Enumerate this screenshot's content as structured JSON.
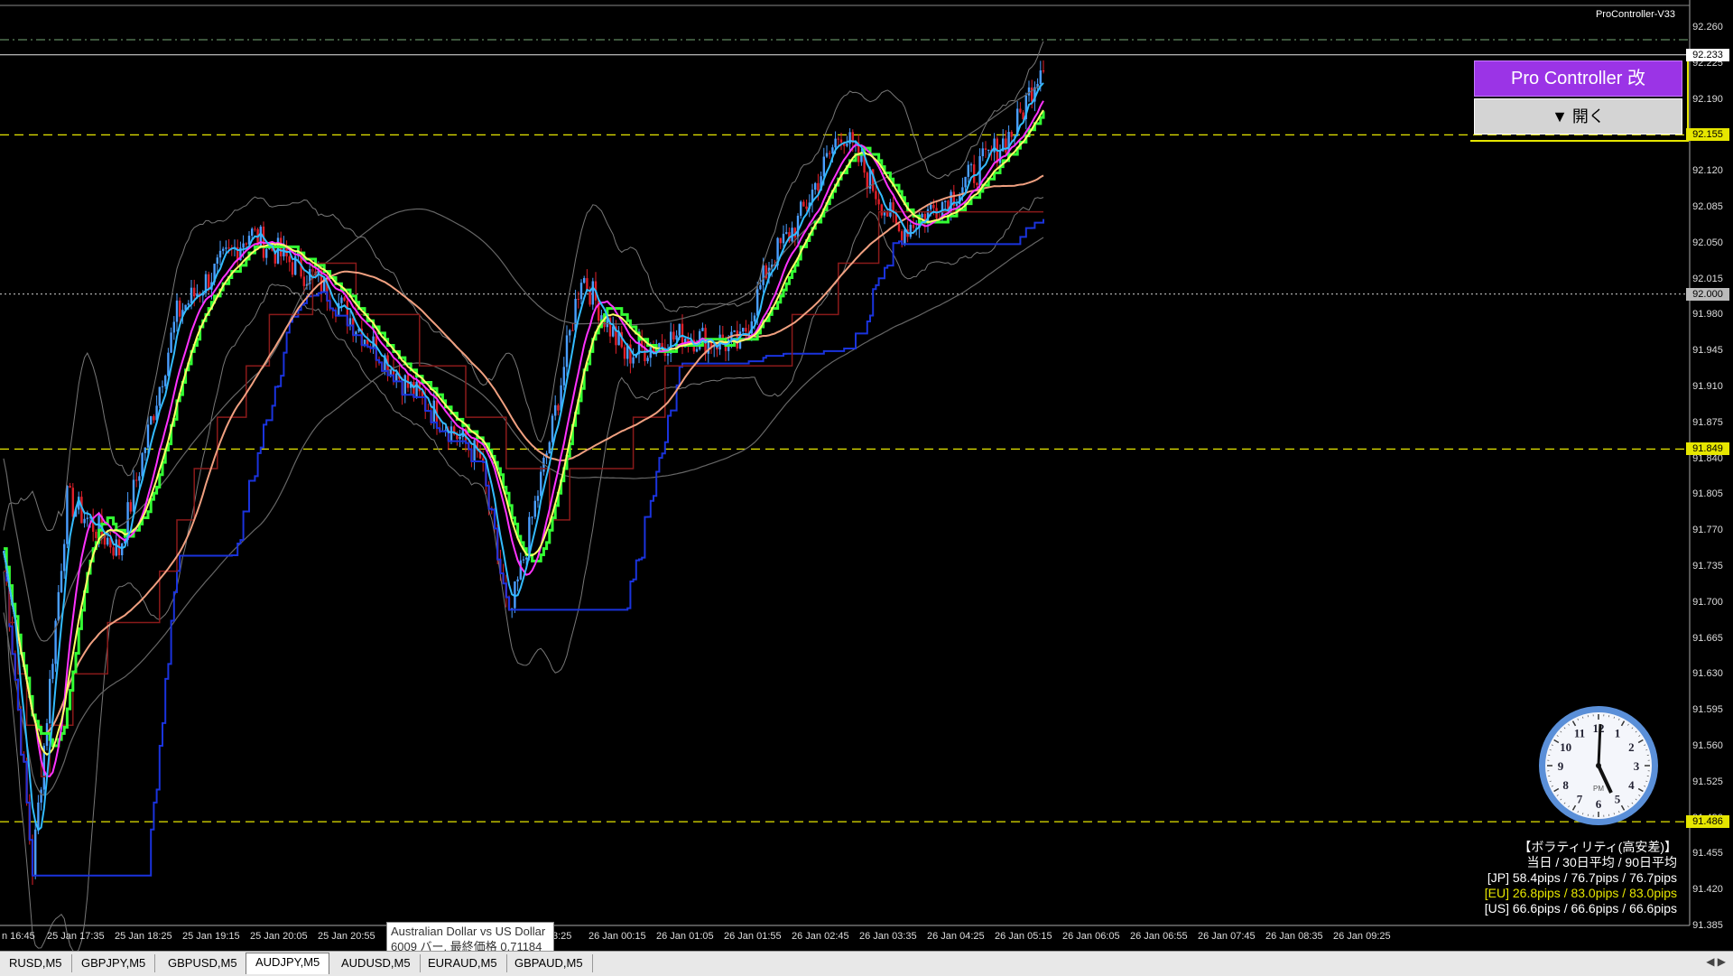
{
  "ea": {
    "name": "ProController-V33",
    "title": "Pro Controller 改",
    "open_label": "▼ 開く"
  },
  "price_axis": {
    "ticks": [
      "92.260",
      "92.225",
      "92.190",
      "92.155",
      "92.120",
      "92.085",
      "92.050",
      "92.015",
      "91.980",
      "91.945",
      "91.910",
      "91.875",
      "91.840",
      "91.805",
      "91.770",
      "91.735",
      "91.700",
      "91.665",
      "91.630",
      "91.595",
      "91.560",
      "91.525",
      "91.490",
      "91.455",
      "91.420",
      "91.385"
    ],
    "current": "92.233",
    "level_upper": "92.155",
    "level_mid": "92.000",
    "level_lower": "91.849",
    "level_bottom": "91.486"
  },
  "time_axis": {
    "labels": [
      "n 16:45",
      "25 Jan 17:35",
      "25 Jan 18:25",
      "25 Jan 19:15",
      "25 Jan 20:05",
      "25 Jan 20:55",
      "3:25",
      "26 Jan 00:15",
      "26 Jan 01:05",
      "26 Jan 01:55",
      "26 Jan 02:45",
      "26 Jan 03:35",
      "26 Jan 04:25",
      "26 Jan 05:15",
      "26 Jan 06:05",
      "26 Jan 06:55",
      "26 Jan 07:45",
      "26 Jan 08:35",
      "26 Jan 09:25"
    ]
  },
  "tooltip": {
    "line1": "Australian Dollar vs US Dollar",
    "line2": "6009 バー, 最終価格 0.71184"
  },
  "volatility": {
    "title": "【ボラティリティ(高安差)】",
    "header": "当日 / 30日平均 / 90日平均",
    "jp": "[JP] 58.4pips / 76.7pips / 76.7pips",
    "eu": "[EU] 26.8pips / 83.0pips / 83.0pips",
    "us": "[US] 66.6pips / 66.6pips / 66.6pips",
    "jp_color": "#ffffff",
    "eu_color": "#e6e600",
    "us_color": "#ffffff"
  },
  "clock": {
    "ampm": "PM",
    "numbers": [
      "12",
      "1",
      "2",
      "3",
      "4",
      "5",
      "6",
      "7",
      "8",
      "9",
      "10",
      "11"
    ]
  },
  "tabs": [
    {
      "label": "RUSD,M5",
      "active": false
    },
    {
      "label": "GBPJPY,M5",
      "active": false
    },
    {
      "label": "GBPUSD,M5",
      "active": false
    },
    {
      "label": "AUDJPY,M5",
      "active": true
    },
    {
      "label": "AUDUSD,M5",
      "active": false
    },
    {
      "label": "EURAUD,M5",
      "active": false
    },
    {
      "label": "GBPAUD,M5",
      "active": false
    }
  ],
  "colors": {
    "bull": "#4a9eff",
    "bear": "#e0202a",
    "ma_fast": "#ffff66",
    "ma_mid": "#ff33ff",
    "ma_step": "#33ff33",
    "ma_slow": "#f0a080",
    "signal": "#33bbff",
    "band": "#777777",
    "level": "#e6e600"
  }
}
